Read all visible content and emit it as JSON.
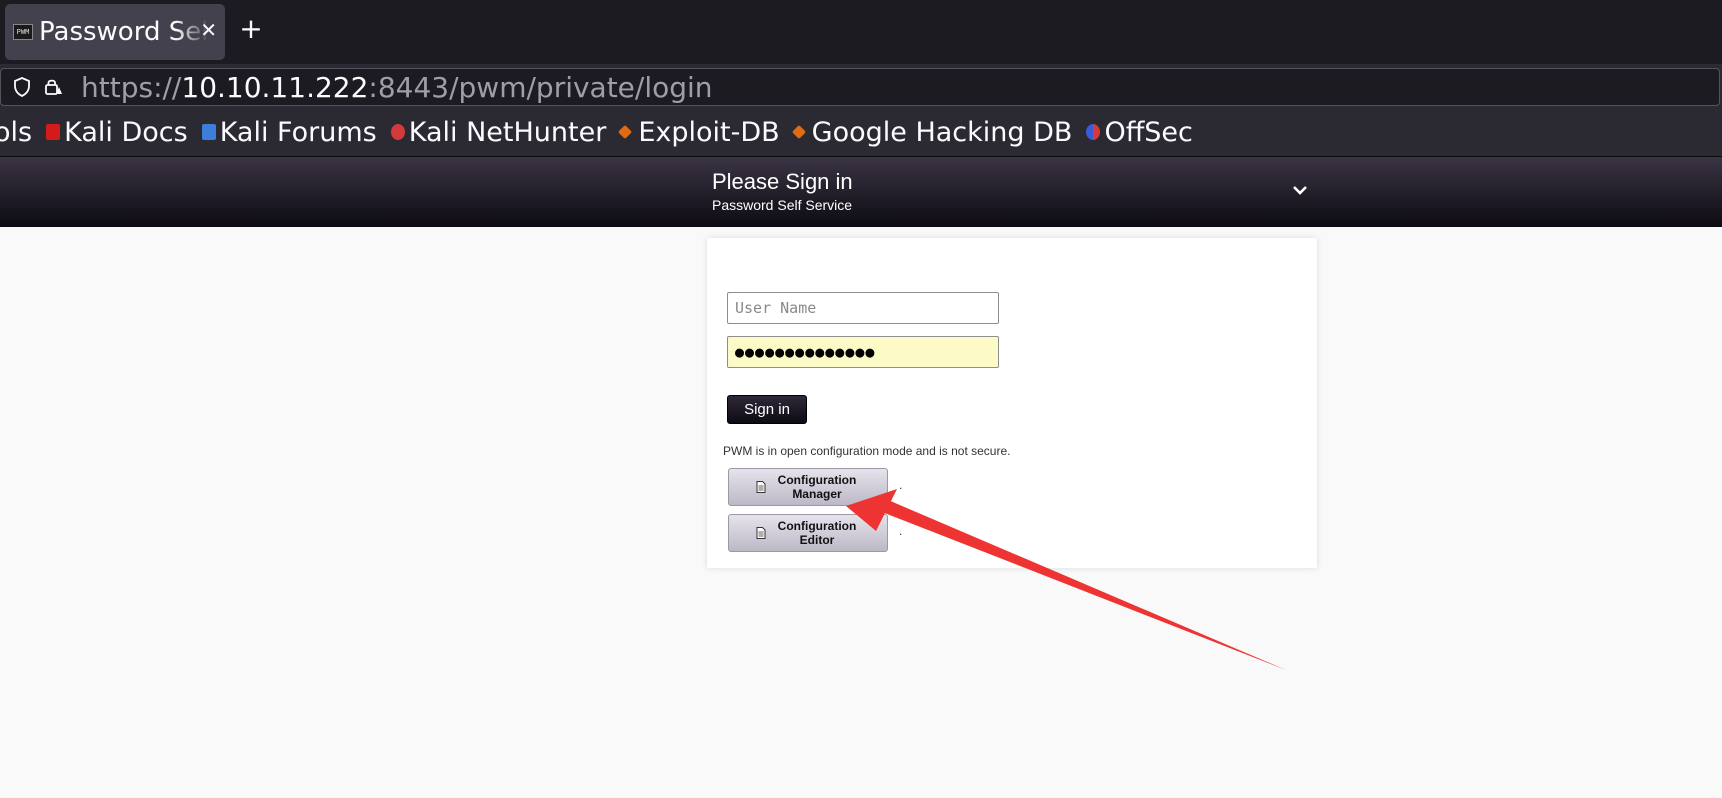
{
  "browser": {
    "tab_title": "Password Self Service",
    "tab_favicon_text": "PWM",
    "url_scheme": "https://",
    "url_host": "10.10.11.222",
    "url_rest": ":8443/pwm/private/login",
    "bookmarks": [
      {
        "label": "ols",
        "icon": "partial",
        "color": ""
      },
      {
        "label": "Kali Docs",
        "icon": "kali-docs-icon",
        "color": "#d31b1b"
      },
      {
        "label": "Kali Forums",
        "icon": "kali-forums-icon",
        "color": "#3b7fd8"
      },
      {
        "label": "Kali NetHunter",
        "icon": "kali-nethunter-icon",
        "color": "#d43a3a"
      },
      {
        "label": "Exploit-DB",
        "icon": "exploit-db-icon",
        "color": "#e06b12"
      },
      {
        "label": "Google Hacking DB",
        "icon": "ghdb-icon",
        "color": "#e06b12"
      },
      {
        "label": "OffSec",
        "icon": "offsec-icon",
        "color": "#3a5ad8"
      }
    ]
  },
  "header": {
    "title": "Please Sign in",
    "subtitle": "Password Self Service"
  },
  "login": {
    "username_placeholder": "User Name",
    "username_value": "",
    "password_value": "●●●●●●●●●●●●●●",
    "sign_in_label": "Sign in",
    "notice": "PWM is in open configuration mode and is not secure.",
    "config_manager_label": "Configuration Manager",
    "config_editor_label": "Configuration Editor",
    "dot": "."
  },
  "annotation": {
    "arrow_color": "#ee3333"
  }
}
